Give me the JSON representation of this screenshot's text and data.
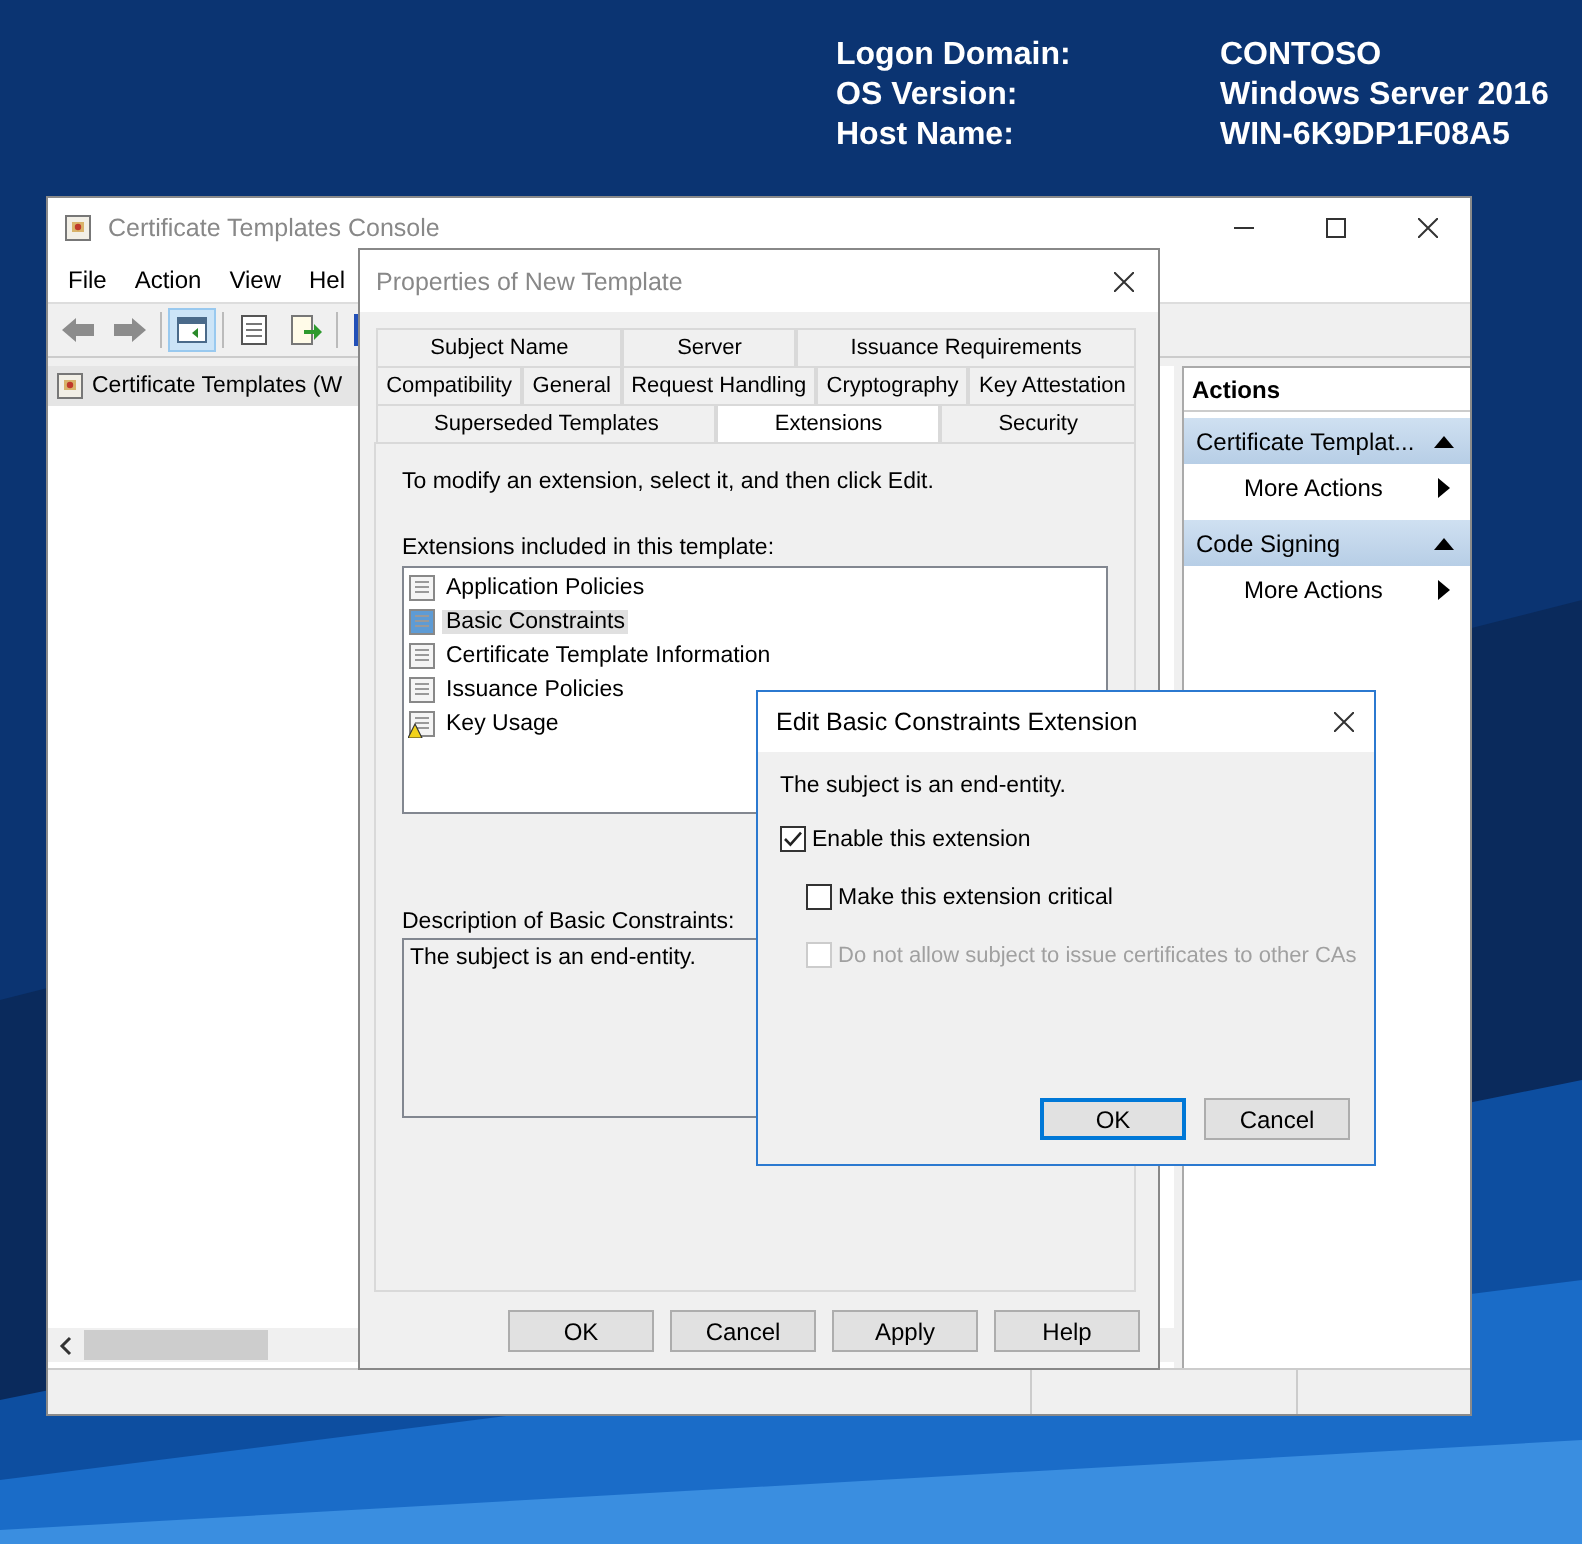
{
  "desktop_info": [
    {
      "label": "Logon Domain:",
      "value": "CONTOSO"
    },
    {
      "label": "OS Version:",
      "value": "Windows Server 2016"
    },
    {
      "label": "Host Name:",
      "value": "WIN-6K9DP1F08A5"
    }
  ],
  "console": {
    "title": "Certificate Templates Console",
    "menu": [
      "File",
      "Action",
      "View",
      "Hel"
    ],
    "tree": [
      {
        "label": "Certificate Templates (W",
        "selected": true
      }
    ],
    "actions": {
      "title": "Actions",
      "items": [
        {
          "kind": "header",
          "label": "Certificate Templat..."
        },
        {
          "kind": "action",
          "label": "More Actions"
        },
        {
          "kind": "header",
          "label": "Code Signing"
        },
        {
          "kind": "action",
          "label": "More Actions"
        }
      ]
    }
  },
  "properties_dialog": {
    "title": "Properties of New Template",
    "tab_rows": [
      [
        {
          "label": "Subject Name",
          "selected": false
        },
        {
          "label": "Server",
          "selected": false
        },
        {
          "label": "Issuance Requirements",
          "selected": false
        }
      ],
      [
        {
          "label": "Compatibility",
          "selected": false
        },
        {
          "label": "General",
          "selected": false
        },
        {
          "label": "Request Handling",
          "selected": false
        },
        {
          "label": "Cryptography",
          "selected": false
        },
        {
          "label": "Key Attestation",
          "selected": false
        }
      ],
      [
        {
          "label": "Superseded Templates",
          "selected": false
        },
        {
          "label": "Extensions",
          "selected": true
        },
        {
          "label": "Security",
          "selected": false
        }
      ]
    ],
    "instruction": "To modify an extension, select it, and then click Edit.",
    "list_label": "Extensions included in this template:",
    "extensions": [
      {
        "label": "Application Policies",
        "selected": false,
        "kind": "normal"
      },
      {
        "label": "Basic Constraints",
        "selected": true,
        "kind": "normal"
      },
      {
        "label": "Certificate Template Information",
        "selected": false,
        "kind": "normal"
      },
      {
        "label": "Issuance Policies",
        "selected": false,
        "kind": "normal"
      },
      {
        "label": "Key Usage",
        "selected": false,
        "kind": "warning"
      }
    ],
    "description_label": "Description of Basic Constraints:",
    "description": "The subject is an end-entity.",
    "buttons": [
      "OK",
      "Cancel",
      "Apply",
      "Help"
    ]
  },
  "edit_dialog": {
    "title": "Edit Basic Constraints Extension",
    "subject_text": "The subject is an end-entity.",
    "checkboxes": [
      {
        "label": "Enable this extension",
        "checked": true,
        "disabled": false,
        "children": [
          {
            "label": "Make this extension critical",
            "checked": false,
            "disabled": false
          },
          {
            "label": "Do not allow subject to issue certificates to other CAs",
            "checked": false,
            "disabled": true
          }
        ]
      }
    ],
    "buttons": [
      {
        "label": "OK",
        "default": true
      },
      {
        "label": "Cancel",
        "default": false
      }
    ]
  }
}
